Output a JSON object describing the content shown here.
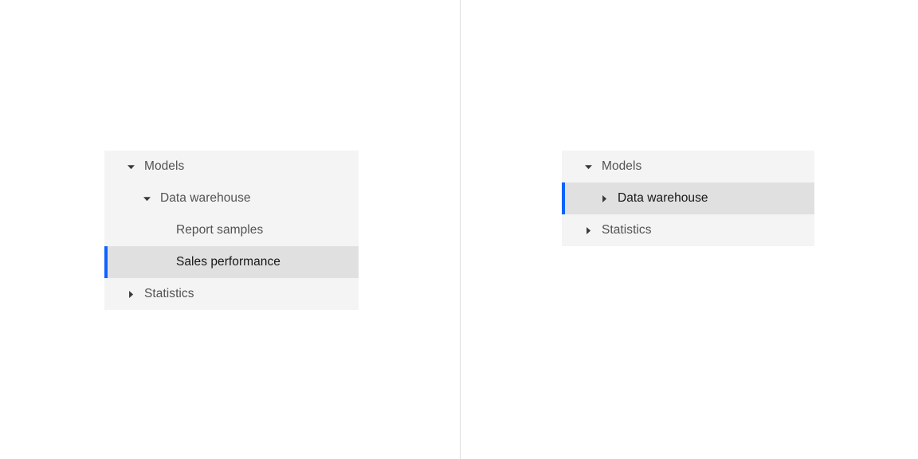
{
  "theme": {
    "panel_bg": "#f4f4f4",
    "selected_bg": "#e0e0e0",
    "selected_bar": "#0f62fe",
    "label_color": "#525252",
    "selected_label_color": "#161616",
    "divider_color": "#dcdcdc",
    "page_bg": "#ffffff"
  },
  "trees": [
    {
      "id": "tree-expanded-example",
      "name": "tree-view-expanded",
      "nodes": [
        {
          "label": "Models",
          "level": 0,
          "state": "expanded",
          "icon": "caret-down-icon",
          "selected": false
        },
        {
          "label": "Data warehouse",
          "level": 1,
          "state": "expanded",
          "icon": "caret-down-icon",
          "selected": false
        },
        {
          "label": "Report samples",
          "level": 2,
          "state": "leaf",
          "icon": "",
          "selected": false
        },
        {
          "label": "Sales performance",
          "level": 2,
          "state": "leaf",
          "icon": "",
          "selected": true
        },
        {
          "label": "Statistics",
          "level": 0,
          "state": "collapsed",
          "icon": "caret-right-icon",
          "selected": false
        }
      ]
    },
    {
      "id": "tree-collapsed-example",
      "name": "tree-view-collapsed",
      "nodes": [
        {
          "label": "Models",
          "level": 0,
          "state": "expanded",
          "icon": "caret-down-icon",
          "selected": false
        },
        {
          "label": "Data warehouse",
          "level": 1,
          "state": "collapsed",
          "icon": "caret-right-icon",
          "selected": true
        },
        {
          "label": "Statistics",
          "level": 0,
          "state": "collapsed",
          "icon": "caret-right-icon",
          "selected": false
        }
      ]
    }
  ]
}
